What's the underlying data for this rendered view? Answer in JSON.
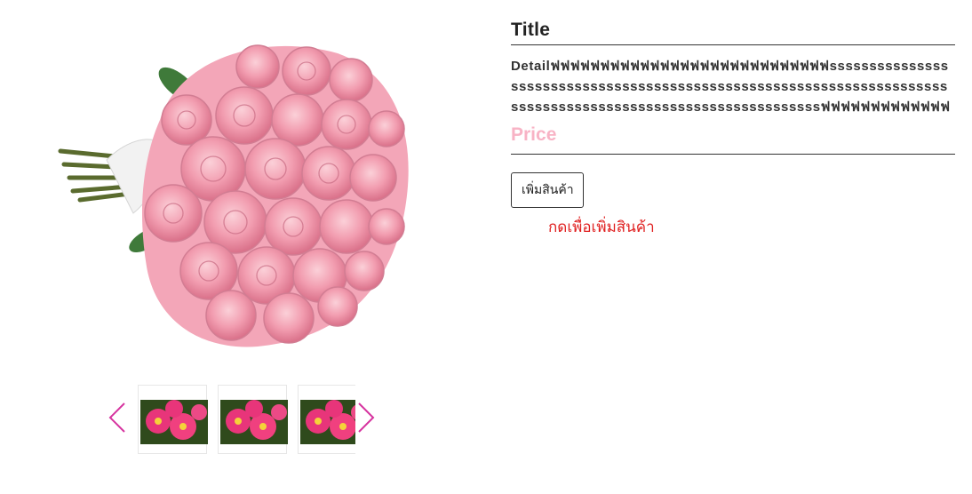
{
  "product": {
    "title": "Title",
    "detail": "Detailฟฟฟฟฟฟฟฟฟฟฟฟฟฟฟฟฟฟฟฟฟฟฟฟฟฟฟฟsssssssssssssssssssssssssssssssssssssssssssssssssssssssssssssssssssssssssssssssssssssssssssssssssssssssssssssฟฟฟฟฟฟฟฟฟฟฟฟฟ",
    "price_label": "Price",
    "add_button_label": "เพิ่มสินค้า",
    "add_hint": "กดเพื่อเพิ่มสินค้า",
    "image_icon": "rose-bouquet",
    "price_color": "#f8b3c5",
    "hint_color": "#e02020"
  },
  "gallery": {
    "prev_icon": "chevron-left-icon",
    "next_icon": "chevron-right-icon",
    "arrow_color": "#d6339f",
    "thumbnails": [
      {
        "alt": "pink flowers"
      },
      {
        "alt": "pink flowers"
      },
      {
        "alt": "pink flowers"
      }
    ]
  }
}
